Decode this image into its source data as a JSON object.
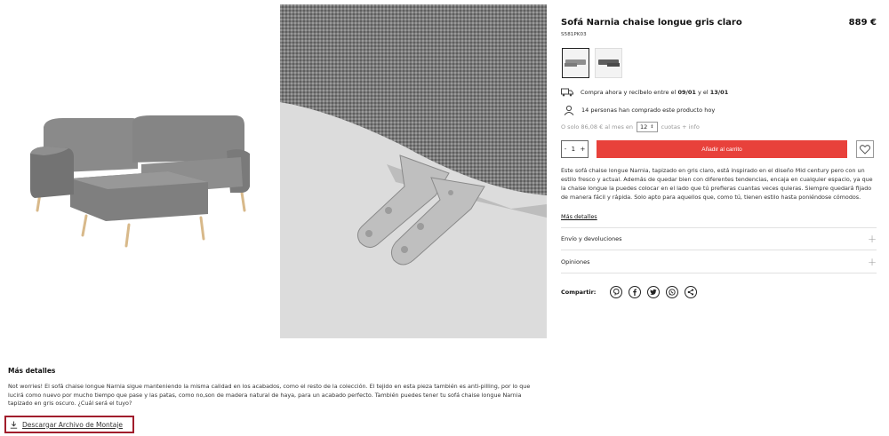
{
  "product": {
    "title": "Sofá Narnia chaise longue gris claro",
    "price": "889 €",
    "sku": "S581PK03"
  },
  "swatches": [
    {
      "name": "Gris claro",
      "selected": true
    },
    {
      "name": "Gris oscuro",
      "selected": false
    }
  ],
  "delivery": {
    "prefix": "Compra ahora y recíbelo entre el ",
    "from": "09/01",
    "middle": " y el ",
    "to": "13/01"
  },
  "buyers_text": "14 personas han comprado este producto hoy",
  "installments": {
    "prefix": "O solo 86,08 € al mes en",
    "months": "12",
    "suffix": "cuotas + info"
  },
  "quantity": {
    "minus": "-",
    "value": "1",
    "plus": "+"
  },
  "add_to_cart": "Añadir al carrito",
  "description": "Este sofá chaise longue Narnia, tapizado en gris claro, está inspirado en el diseño Mid century pero con un estilo fresco y actual. Además de quedar bien con diferentes tendencias, encaja en cualquier espacio, ya que la chaise longue la puedes colocar en el lado que tú prefieras cuantas veces quieras. Siempre quedará fijado de manera fácil y rápida. Solo apto para aquellos que, como tú, tienen estilo hasta poniéndose cómodos.",
  "more_details_link": "Más detalles",
  "accordions": {
    "shipping": "Envío y devoluciones",
    "reviews": "Opiniones",
    "plus": "+"
  },
  "share": {
    "label": "Compartir:",
    "icons": [
      "pinterest-icon",
      "facebook-icon",
      "twitter-icon",
      "whatsapp-icon",
      "share-icon"
    ]
  },
  "details": {
    "title": "Más detalles",
    "text": "Not worries! El sofá chaise longue Narnia sigue manteniendo la misma calidad en los acabados, como el resto de la colección. El tejido en esta pieza también es anti-pilling, por lo que lucirá como nuevo por mucho tiempo que pase y las patas, como no,son de madera natural de haya, para un acabado perfecto. También puedes tener tu sofá chaise longue Narnia tapizado en gris oscuro. ¿Cuál será el tuyo?",
    "download": "Descargar Archivo de Montaje"
  },
  "colors": {
    "accent": "#e8413b",
    "highlight_border": "#a11d2c",
    "sofa_grey": "#7e7e7e",
    "wood": "#d9b98c"
  }
}
